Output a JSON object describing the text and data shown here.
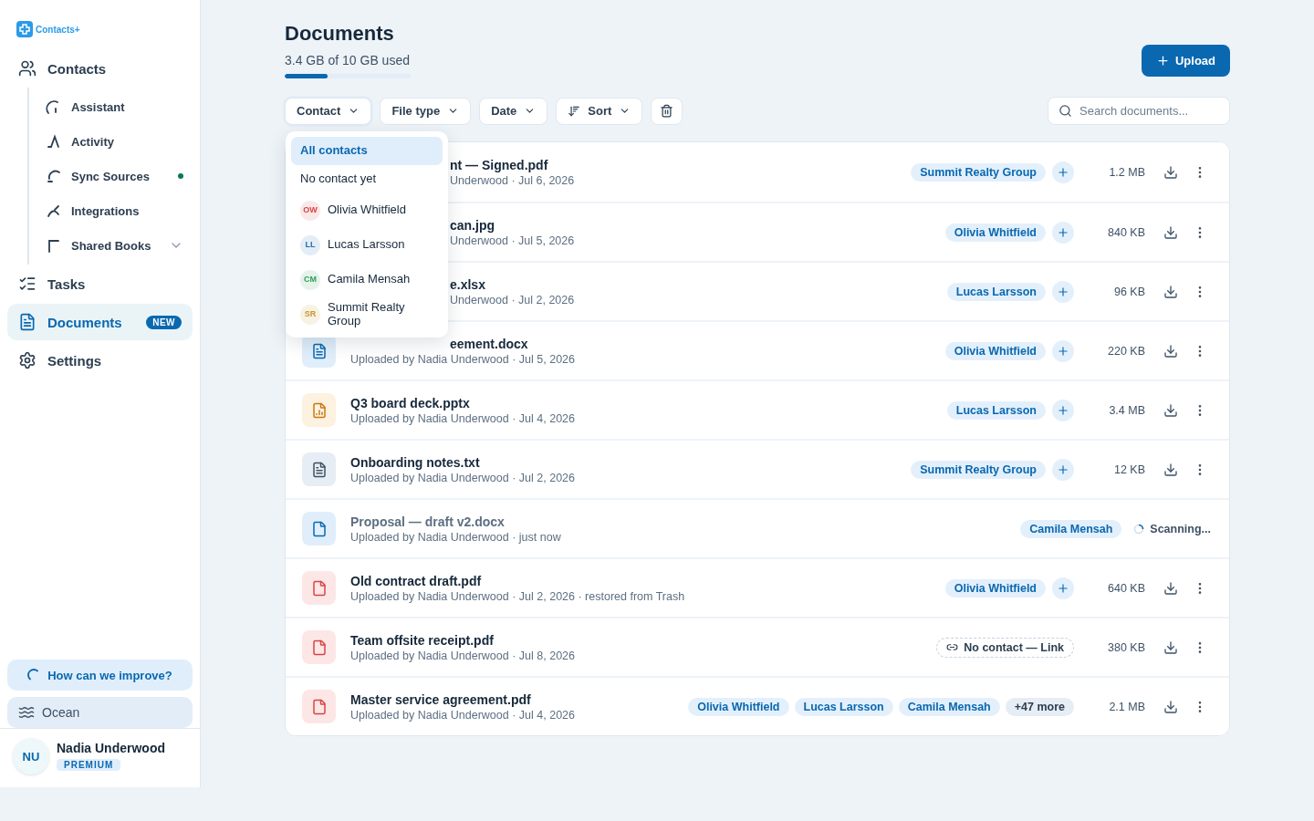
{
  "sidebar": {
    "logo": "Contacts+",
    "items": [
      {
        "label": "Contacts",
        "selected": false,
        "children": [
          {
            "label": "Assistant",
            "dot": false
          },
          {
            "label": "Activity",
            "dot": false
          },
          {
            "label": "Sync Sources",
            "dot": true
          },
          {
            "label": "Integrations",
            "dot": false
          },
          {
            "label": "Shared Books",
            "dot": false,
            "expanded": false
          }
        ]
      },
      {
        "label": "Tasks",
        "selected": false
      },
      {
        "label": "Documents",
        "selected": true,
        "badge": "NEW"
      },
      {
        "label": "Settings",
        "selected": false
      }
    ],
    "feedback": "How can we improve?",
    "theme": "Ocean",
    "user": {
      "initials": "NU",
      "name": "Nadia Underwood",
      "plan": "PREMIUM"
    }
  },
  "header": {
    "title": "Documents",
    "storage": "3.4 GB of 10 GB used",
    "level": 0.34,
    "upload": "Upload"
  },
  "filters": [
    {
      "kind": "dropdown",
      "label": "Contact",
      "open": true
    },
    {
      "kind": "dropdown",
      "label": "File type",
      "open": false
    },
    {
      "kind": "dropdown",
      "label": "Date",
      "open": false
    },
    {
      "kind": "sort",
      "label": "Sort",
      "open": false
    },
    {
      "kind": "trash"
    }
  ],
  "search": {
    "placeholder": "Search documents..."
  },
  "contact_menu": [
    {
      "label": "All contacts",
      "selected": true
    },
    {
      "label": "No contact yet",
      "selected": false
    },
    {
      "label": "Olivia Whitfield",
      "initials": "OW",
      "color": "#d64545",
      "selected": false
    },
    {
      "label": "Lucas Larsson",
      "initials": "LL",
      "color": "#1f6fb5",
      "selected": false
    },
    {
      "label": "Camila Mensah",
      "initials": "CM",
      "color": "#2e9e5b",
      "selected": false
    },
    {
      "label": "Summit Realty Group",
      "initials": "SR",
      "color": "#c9962a",
      "selected": false
    }
  ],
  "documents": [
    {
      "name": "nt — Signed.pdf",
      "meta": "Underwood · Jul 6, 2026",
      "name_cut": true,
      "meta_cut": true,
      "processing": false,
      "can_add": true,
      "chips": [
        {
          "kind": "contact",
          "label": "Summit Realty Group"
        }
      ],
      "status": {
        "kind": "size",
        "text": "1.2 MB"
      }
    },
    {
      "name": "can.jpg",
      "meta": "Underwood · Jul 5, 2026",
      "name_cut": true,
      "meta_cut": true,
      "processing": false,
      "can_add": true,
      "chips": [
        {
          "kind": "contact",
          "label": "Olivia Whitfield"
        }
      ],
      "status": {
        "kind": "size",
        "text": "840 KB"
      }
    },
    {
      "name": "e.xlsx",
      "meta": "Underwood · Jul 2, 2026",
      "name_cut": true,
      "meta_cut": true,
      "processing": false,
      "can_add": true,
      "chips": [
        {
          "kind": "contact",
          "label": "Lucas Larsson"
        }
      ],
      "status": {
        "kind": "size",
        "text": "96 KB"
      }
    },
    {
      "name": "eement.docx",
      "meta": "Uploaded by Nadia Underwood · Jul 5, 2026",
      "kind": "doc",
      "name_cut": true,
      "processing": false,
      "can_add": true,
      "chips": [
        {
          "kind": "contact",
          "label": "Olivia Whitfield"
        }
      ],
      "status": {
        "kind": "size",
        "text": "220 KB"
      }
    },
    {
      "name": "Q3 board deck.pptx",
      "meta": "Uploaded by Nadia Underwood · Jul 4, 2026",
      "kind": "slides",
      "processing": false,
      "can_add": true,
      "chips": [
        {
          "kind": "contact",
          "label": "Lucas Larsson"
        }
      ],
      "status": {
        "kind": "size",
        "text": "3.4 MB"
      }
    },
    {
      "name": "Onboarding notes.txt",
      "meta": "Uploaded by Nadia Underwood · Jul 2, 2026",
      "kind": "text",
      "processing": false,
      "can_add": true,
      "chips": [
        {
          "kind": "contact",
          "label": "Summit Realty Group"
        }
      ],
      "status": {
        "kind": "size",
        "text": "12 KB"
      }
    },
    {
      "name": "Proposal — draft v2.docx",
      "meta": "Uploaded by Nadia Underwood · just now",
      "kind": "draft",
      "processing": true,
      "can_add": false,
      "chips": [
        {
          "kind": "contact",
          "label": "Camila Mensah"
        }
      ],
      "status": {
        "kind": "scanning",
        "text": "Scanning..."
      }
    },
    {
      "name": "Old contract draft.pdf",
      "meta": "Uploaded by Nadia Underwood · Jul 2, 2026 · restored from Trash",
      "kind": "pdf",
      "processing": false,
      "can_add": true,
      "chips": [
        {
          "kind": "contact",
          "label": "Olivia Whitfield"
        }
      ],
      "status": {
        "kind": "size",
        "text": "640 KB"
      }
    },
    {
      "name": "Team offsite receipt.pdf",
      "meta": "Uploaded by Nadia Underwood · Jul 8, 2026",
      "kind": "pdf",
      "processing": false,
      "can_add": false,
      "chips": [
        {
          "kind": "link",
          "label": "No contact — Link"
        }
      ],
      "status": {
        "kind": "size",
        "text": "380 KB"
      }
    },
    {
      "name": "Master service agreement.pdf",
      "meta": "Uploaded by Nadia Underwood · Jul 4, 2026",
      "kind": "pdf",
      "processing": false,
      "can_add": false,
      "chips": [
        {
          "kind": "contact",
          "label": "Olivia Whitfield"
        },
        {
          "kind": "contact",
          "label": "Lucas Larsson"
        },
        {
          "kind": "contact",
          "label": "Camila Mensah"
        },
        {
          "kind": "more",
          "label": "+47 more"
        }
      ],
      "status": {
        "kind": "size",
        "text": "2.1 MB"
      }
    }
  ]
}
